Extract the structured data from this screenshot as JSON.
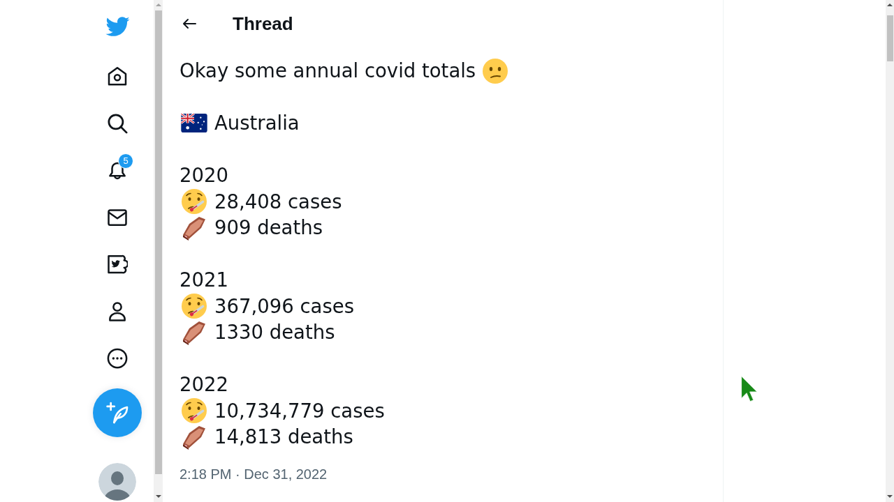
{
  "sidebar": {
    "items": [
      {
        "kind": "logo"
      },
      {
        "kind": "home"
      },
      {
        "kind": "explore"
      },
      {
        "kind": "notifications",
        "badge": "5"
      },
      {
        "kind": "messages"
      },
      {
        "kind": "blue"
      },
      {
        "kind": "profile"
      },
      {
        "kind": "more"
      }
    ]
  },
  "header": {
    "title": "Thread"
  },
  "tweet": {
    "paragraphs": [
      [
        {
          "kind": "remark",
          "text": "Okay some annual covid totals"
        }
      ],
      [
        {
          "kind": "country",
          "text": "Australia"
        }
      ],
      [
        {
          "kind": "year",
          "text": "2020"
        },
        {
          "kind": "cases",
          "text": "28,408 cases"
        },
        {
          "kind": "deaths",
          "text": "909 deaths"
        }
      ],
      [
        {
          "kind": "year",
          "text": "2021"
        },
        {
          "kind": "cases",
          "text": "367,096 cases"
        },
        {
          "kind": "deaths",
          "text": "1330 deaths"
        }
      ],
      [
        {
          "kind": "year",
          "text": "2022"
        },
        {
          "kind": "cases",
          "text": "10,734,779 cases"
        },
        {
          "kind": "deaths",
          "text": "14,813 deaths"
        }
      ]
    ],
    "timestamp": "2:18 PM · Dec 31, 2022"
  }
}
